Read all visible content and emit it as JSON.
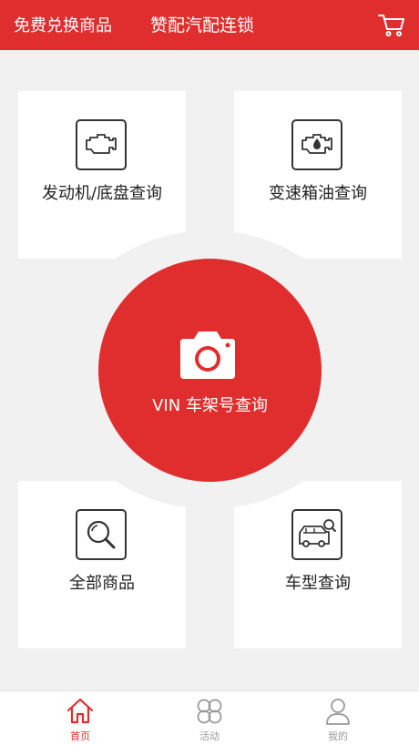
{
  "header": {
    "promo_label": "免费兑换商品",
    "title": "赞配汽配连锁",
    "cart_icon": "cart-icon"
  },
  "cards": {
    "engine_label": "发动机/底盘查询",
    "gearbox_label": "变速箱油查询",
    "all_label": "全部商品",
    "model_label": "车型查询"
  },
  "vin": {
    "label": "VIN 车架号查询",
    "icon": "camera-icon"
  },
  "tabs": [
    {
      "label": "首页",
      "icon": "home-icon",
      "active": true
    },
    {
      "label": "活动",
      "icon": "activity-icon",
      "active": false
    },
    {
      "label": "我的",
      "icon": "user-icon",
      "active": false
    }
  ],
  "colors": {
    "brand_red": "#e02e2e",
    "background": "#f2f1f1",
    "tab_inactive": "#999999"
  }
}
